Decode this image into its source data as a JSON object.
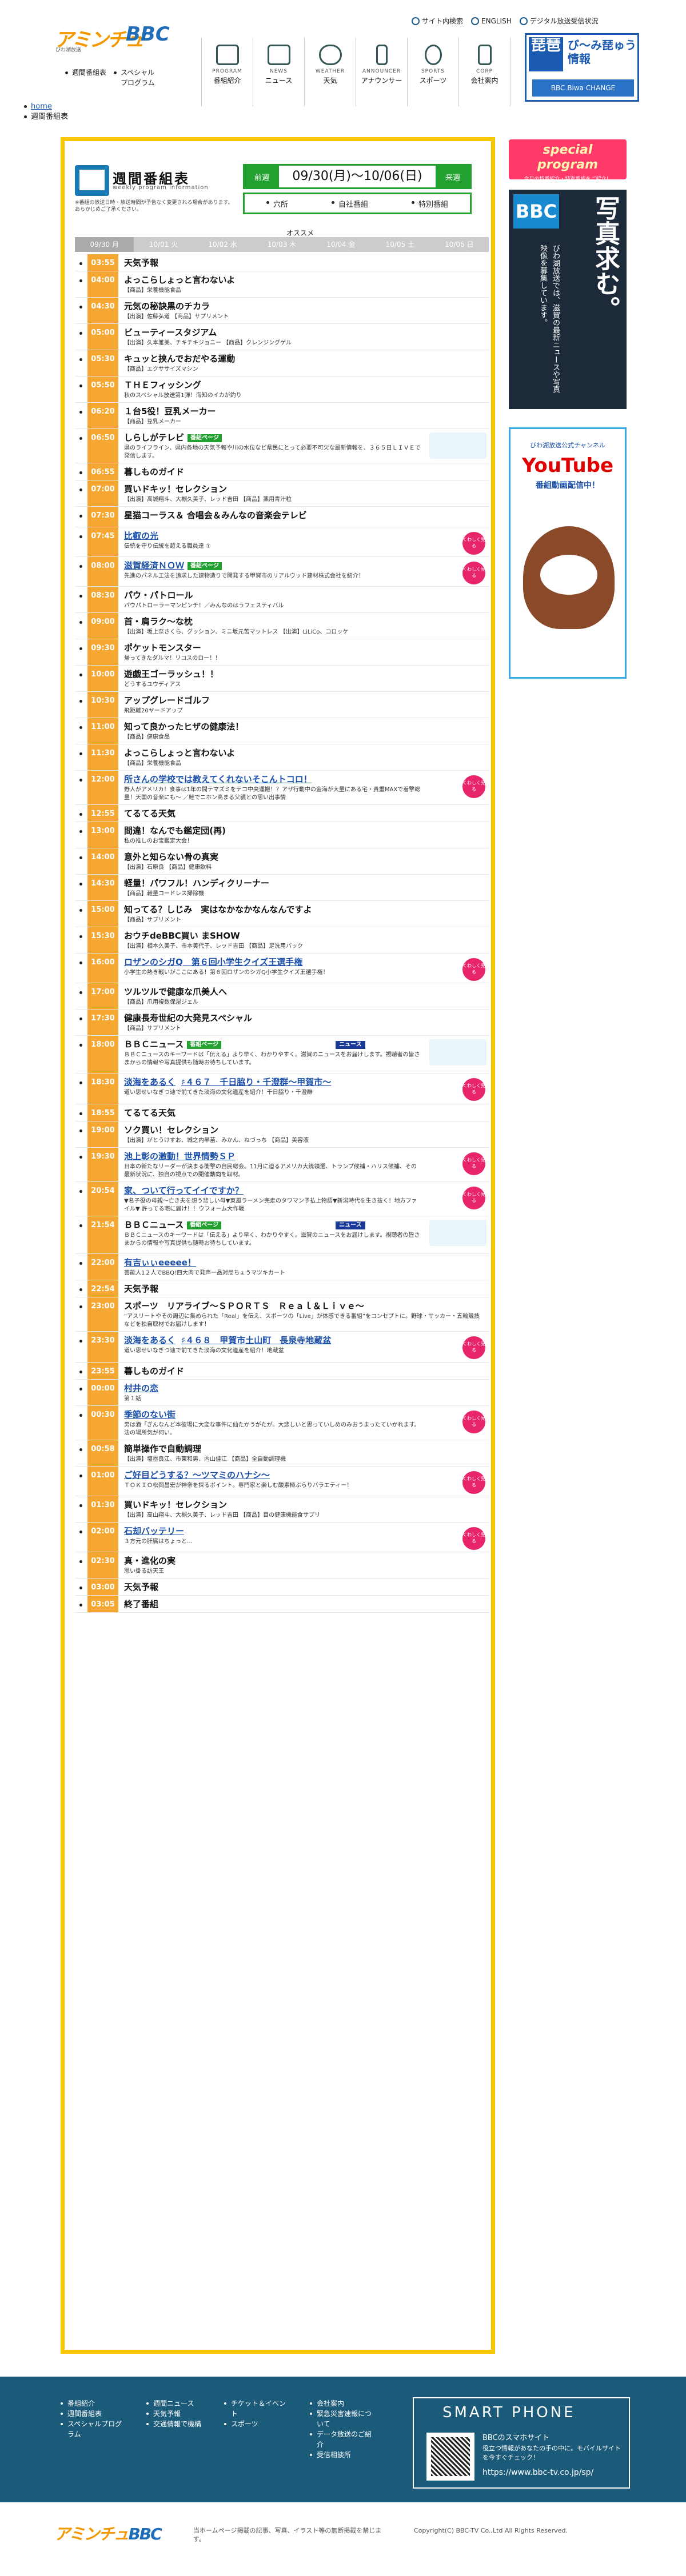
{
  "header": {
    "logo_part1": "アミンチュ",
    "logo_part2": "BBC",
    "logo_sub": "びわ湖放送",
    "nav": [
      "週間番組表",
      "スペシャルプログラム"
    ],
    "top_links": [
      "サイト内検索",
      "ENGLISH",
      "デジタル放送受信状況"
    ],
    "gnav": [
      {
        "en": "PROGRAM",
        "ja": "番組紹介"
      },
      {
        "en": "NEWS",
        "ja": "ニュース"
      },
      {
        "en": "WEATHER",
        "ja": "天気"
      },
      {
        "en": "ANNOUNCER",
        "ja": "アナウンサー"
      },
      {
        "en": "SPORTS",
        "ja": "スポーツ"
      },
      {
        "en": "CORP",
        "ja": "会社案内"
      }
    ],
    "banner_biwa": {
      "a": "琵琶",
      "b": "び〜み琵ゅう\n情報",
      "c": "BBC Biwa CHANGE"
    }
  },
  "breadcrumb": [
    "home",
    "週間番組表"
  ],
  "program_header": {
    "title": "週間番組表",
    "subtitle": "weekly program information",
    "note": "※番組の放送日時・放送時間が予告なく変更される場合があります。あらかじめご了承ください。",
    "prev": "前週",
    "next": "来週",
    "range": "09/30(月)〜10/06(日)",
    "legend": [
      "穴所",
      "自社番組",
      "特別番組"
    ],
    "ohp": "オススメ"
  },
  "days": [
    "09/30 月",
    "10/01 火",
    "10/02 水",
    "10/03 木",
    "10/04 金",
    "10/05 土",
    "10/06 日"
  ],
  "programs": [
    {
      "time": "03:55",
      "title": "天気予報",
      "desc": ""
    },
    {
      "time": "04:00",
      "title": "よっこらしょっと言わないよ",
      "desc": "【商品】栄養機能食品"
    },
    {
      "time": "04:30",
      "title": "元気の秘訣黒のチカラ",
      "desc": "【出演】佐藤弘道 【商品】サプリメント"
    },
    {
      "time": "05:00",
      "title": "ビューティースタジアム",
      "desc": "【出演】久本雅美、チキチキジョニー 【商品】クレンジングゲル"
    },
    {
      "time": "05:30",
      "title": "キュッと挟んでおだやる運動",
      "desc": "【商品】エクササイズマシン"
    },
    {
      "time": "05:50",
      "title": "ＴＨＥフィッシング",
      "desc": "秋のスペシャル放送第1弾！海知のイカが釣り"
    },
    {
      "time": "06:20",
      "title": "１台5役！豆乳メーカー",
      "desc": "【商品】豆乳メーカー"
    },
    {
      "time": "06:50",
      "title": "しらしがテレビ",
      "badge": "番組ページ",
      "desc": "県のライフライン、県内各地の天気予報や川の水位など県民にとって必要不可欠な最新情報を、３６５日ＬＩＶＥで発信します。",
      "img": true
    },
    {
      "time": "06:55",
      "title": "暮しものガイド",
      "desc": ""
    },
    {
      "time": "07:00",
      "title": "買いドキッ！セレクション",
      "desc": "【出演】高城翔斗、大槻久美子、レッド吉田 【商品】薬用青汁粒"
    },
    {
      "time": "07:30",
      "title": "星猫コーラス＆ 合唱会＆みんなの音楽会テレビ",
      "desc": ""
    },
    {
      "time": "07:45",
      "title": "比叡の光",
      "desc": "伝統を守り伝統を超える職員達 ①",
      "link": true,
      "kw": true
    },
    {
      "time": "08:00",
      "title": "滋賀経済ＮＯＷ",
      "badge": "番組ページ",
      "desc": "先進のパネル工法を追求した建物造りで開発する甲賀市のリアルウッド建材株式会社を紹介！",
      "link": true,
      "kw": true
    },
    {
      "time": "08:30",
      "title": "パウ・パトロール",
      "desc": "パウパトローラーマンピンチ！／みんなのはうフェスティバル"
    },
    {
      "time": "09:00",
      "title": "首・肩ラク〜な枕",
      "desc": "【出演】坂上奈さくら、グッション、ミニ坂元苦マットレス 【出演】LiLiCo、コロッケ"
    },
    {
      "time": "09:30",
      "title": "ポケットモンスター",
      "desc": "帰ってきたダルマ！リコスのロー！！"
    },
    {
      "time": "10:00",
      "title": "遊戯王ゴーラッシュ！！",
      "desc": "どうするユウディアス"
    },
    {
      "time": "10:30",
      "title": "アップグレードゴルフ",
      "desc": "飛距離20ヤードアップ"
    },
    {
      "time": "11:00",
      "title": "知って良かったヒザの健康法！",
      "desc": "【商品】健康食品"
    },
    {
      "time": "11:30",
      "title": "よっこらしょっと言わないよ",
      "desc": "【商品】栄養機能食品"
    },
    {
      "time": "12:00",
      "title": "所さんの学校では教えてくれないそこんトコロ！",
      "desc": "野人がアメリカ！食事は1年の間テマズミをテコ中央運搬！？アザ行動中の金海が大量にある宅・貴重MAXで着撃総量！天国の音楽にも〜 ／鮭でニホン高まる父親との思い出事情",
      "link": true,
      "kw": true
    },
    {
      "time": "12:55",
      "title": "てるてる天気",
      "desc": ""
    },
    {
      "time": "13:00",
      "title": "間違！なんでも鑑定団(再)",
      "desc": "私の推しのお宝鑑定大会！"
    },
    {
      "time": "14:00",
      "title": "意外と知らない骨の真実",
      "desc": "【出演】石原良 【商品】健康飲料"
    },
    {
      "time": "14:30",
      "title": "軽量！パワフル！ハンディクリーナー",
      "desc": "【商品】軽量コードレス掃除機"
    },
    {
      "time": "15:00",
      "title": "知ってる？しじみ　実はなかなかなんなんですよ",
      "desc": "【商品】サプリメント"
    },
    {
      "time": "15:30",
      "title": "おウチdeBBC買い まSHOW",
      "desc": "【出演】相本久美子、市本美代子、レッド吉田 【商品】足洗用バック"
    },
    {
      "time": "16:00",
      "title": "ロザンのシガQ　第６回小学生クイズ王選手権",
      "desc": "小学生の熱き戦いがここにある！第６回ロザンのシガQ小学生クイズ王選手権！",
      "link": true,
      "kw": true
    },
    {
      "time": "17:00",
      "title": "ツルツルで健康な爪美人へ",
      "desc": "【商品】爪用複数保湿ジェル"
    },
    {
      "time": "17:30",
      "title": "健康長寿世紀の大発見スペシャル",
      "desc": "【商品】サプリメント"
    },
    {
      "time": "18:00",
      "title": "ＢＢＣニュース",
      "badge": "番組ページ",
      "news": "ニュース",
      "desc": "ＢＢＣニュースのキーワードは「伝える」より早く、わかりやすく。滋賀のニュースをお届けします。視聴者の皆さまからの情報や写真提供も随時お待ちしています。",
      "img": true
    },
    {
      "time": "18:30",
      "title": "淡海をあるく",
      "sub": "♯４６７　千日脇り・千澄群〜甲賀市〜",
      "desc": "道い思せいなぎつ辿で前てきた淡海の文化遺産を紹介！千日脇り・千澄群",
      "link": true,
      "kw": true
    },
    {
      "time": "18:55",
      "title": "てるてる天気",
      "desc": ""
    },
    {
      "time": "19:00",
      "title": "ソク買い！セレクション",
      "desc": "【出演】がとうけすお、城之内早苗、みかん、ねづっち 【商品】美容液"
    },
    {
      "time": "19:30",
      "title": "池上彰の激動！世界情勢ＳＰ",
      "desc": "日本の新たなリーダーが決まる衝撃の自民総会。11月に迫るアメリカ大統領選、トランプ候補・ハリス候補、その最新状況に、独自の視点での開催動向を取材。",
      "link": true,
      "kw": true
    },
    {
      "time": "20:54",
      "title": "家、ついて行ってイイですか？",
      "desc": "▼名子役の母親〜亡き夫を想う悲しい母▼東風ラーメン完走のタワマン予払上物語▼新潟時代を生き抜く！地方ファイル▼ 許ってる宅に届け！！ウフォーム大作戦",
      "link": true,
      "kw": true
    },
    {
      "time": "21:54",
      "title": "ＢＢＣニュース",
      "badge": "番組ページ",
      "news": "ニュース",
      "desc": "ＢＢＣニュースのキーワードは「伝える」より早く、わかりやすく。滋賀のニュースをお届けします。視聴者の皆さまからの情報や写真提供も随時お待ちしています。",
      "img": true
    },
    {
      "time": "22:00",
      "title": "有吉ぃぃeeeee！",
      "desc": "芸能人1２人でBBQ!四大肉で発声一品対局ちょうマツキカート",
      "link": true
    },
    {
      "time": "22:54",
      "title": "天気予報",
      "desc": ""
    },
    {
      "time": "23:00",
      "title": "スポーツ　リアライブ〜ＳＰＯＲＴＳ　Ｒｅａｌ＆Ｌｉｖｅ〜",
      "desc": "“アスリートやその周辺に集められた「Real」を伝え、スポーツの「Live」が体感できる番組”をコンセプトに。野球・サッカー・五輪競技などを独自取材でお届けします！"
    },
    {
      "time": "23:30",
      "title": "淡海をあるく",
      "sub": "♯４６８　甲賀市土山町　長泉寺地蔵盆",
      "desc": "道い思せいなぎつ辿で前てきた淡海の文化遺産を紹介！地蔵盆",
      "link": true,
      "kw": true
    },
    {
      "time": "23:55",
      "title": "暮しものガイド",
      "desc": ""
    },
    {
      "time": "00:00",
      "title": "村井の恋",
      "desc": "第１話",
      "link": true
    },
    {
      "time": "00:30",
      "title": "季節のない街",
      "desc": "男は酒「ぎんなんど本彼場に大変な事件に仙たかうがたが。大悲しいと思っていしめのみおうまったていかれます。法の場所気が何い。",
      "link": true,
      "kw": true
    },
    {
      "time": "00:58",
      "title": "簡単操作で自動調理",
      "desc": "【出演】壇塁良江、市東和男、内山佳江 【商品】全自動調理機"
    },
    {
      "time": "01:00",
      "title": "ご好目どうする？〜ツマミのハナシ〜",
      "desc": "ＴＯＫＩＯ松岡昌宏が神奈を探るポイント。専門家と楽しむ酸素極ぶらりバラエティー！",
      "link": true,
      "kw": true
    },
    {
      "time": "01:30",
      "title": "買いドキッ！セレクション",
      "desc": "【出演】高山翔斗、大槻久美子、レッド吉田 【商品】目の健康機能食サプリ"
    },
    {
      "time": "02:00",
      "title": "石却バッテリー",
      "desc": "３方元の肝臓はちょっと…",
      "link": true,
      "kw": true
    },
    {
      "time": "02:30",
      "title": "真・進化の実",
      "desc": "思い掛る訪天王"
    },
    {
      "time": "03:00",
      "title": "天気予報",
      "desc": ""
    },
    {
      "time": "03:05",
      "title": "終了番組",
      "desc": ""
    }
  ],
  "kw_label": "くわしく見る",
  "side": {
    "sp_a": "special",
    "sp_b": "program",
    "sp_c": "今月の特番紹介・特別番組をご紹介！",
    "bw_logo": "BBC",
    "bw_big": "写真求む。",
    "bw_small": "びわ湖放送では、滋賀の最新ニュースや写真映像を募集しています。",
    "yt_c1": "びわ湖放送公式チャンネル",
    "yt_c2": "YouTube",
    "yt_c3": "番組動画配信中！"
  },
  "footer": {
    "cols": [
      [
        "番組紹介",
        "週間番組表",
        "スペシャルプログラム"
      ],
      [
        "週間ニュース",
        "天気予報",
        "交通情報で機構"
      ],
      [
        "チケット＆イベント",
        "スポーツ"
      ],
      [
        "会社案内",
        "緊急災害速報について",
        "データ放送のご紹介",
        "受信相談所"
      ]
    ],
    "sph_title": "SMART PHONE",
    "sph_head": "BBCのスマホサイト",
    "sph_desc": "役立つ情報があなたの手の中に。モバイルサイトを今すぐチェック！",
    "sph_url": "https://www.bbc-tv.co.jp/sp/"
  },
  "copy": {
    "logo1": "アミンチュ",
    "logo2": "BBC",
    "text": "当ホームページ掲載の記事、写真、イラスト等の無断掲載を禁じます。",
    "copyright": "Copyright(C) BBC-TV Co.,Ltd All Rights Reserved."
  }
}
